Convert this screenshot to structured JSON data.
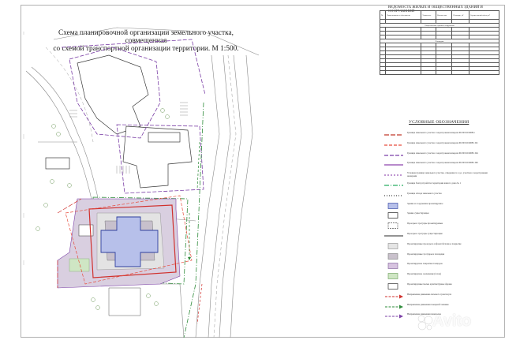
{
  "title_lines": [
    "Схема планировочной организации земельного участка, совмещенная",
    "со схемой транспортной организации территории. М 1:500."
  ],
  "table": {
    "title": "ВЕДОМОСТЬ ЖИЛЫХ И ОБЩЕСТВЕННЫХ ЗДАНИЙ И СООРУЖЕНИЙ",
    "headers": [
      "№",
      "Наименование и обозначение",
      "Этажность",
      "Количество",
      "Площадь, м²",
      "Строительный объем, м³"
    ],
    "section_1": "Общественные здания и сооружения",
    "section_2": "Площадки",
    "colors": {
      "line": "#555555"
    }
  },
  "legend": {
    "title": "УСЛОВНЫЕ ОБОЗНАЧЕНИЯ",
    "items": [
      {
        "label": "Граница земельного участка с кадастровым номером 66:39:0101008:4",
        "symbol": "line",
        "color": "#c0392b",
        "dash": "6 2"
      },
      {
        "label": "Граница земельного участка с кадастровым номером 66:39:0101008:1191",
        "symbol": "line",
        "color": "#e74c3c",
        "dash": "4 2"
      },
      {
        "label": "Граница земельного участка с кадастровым номером 66:39:0101008:1194",
        "symbol": "line",
        "color": "#7b3fa6",
        "dash": "5 2"
      },
      {
        "label": "Граница земельного участка с кадастровым номером 66:39:0101008:1196",
        "symbol": "line",
        "color": "#8e44ad",
        "dash": "none"
      },
      {
        "label": "Условная граница земельного участка, отведенного в д.з. участков с кадастровыми номерами",
        "symbol": "line",
        "color": "#9b59b6",
        "dash": "2 2"
      },
      {
        "label": "Граница благоустройства территории жилого дома № 1",
        "symbol": "line",
        "color": "#27ae60",
        "dash": "6 2 1 2"
      },
      {
        "label": "Граница отвода земельного участка",
        "symbol": "line",
        "color": "#444444",
        "dash": "1 2"
      },
      {
        "label": "Здание и сооружение проектируемое",
        "symbol": "box",
        "color": "#3d4fa8",
        "fill": "#b7c0ea"
      },
      {
        "label": "Здание существующее",
        "symbol": "box",
        "color": "#222222",
        "fill": "#ffffff"
      },
      {
        "label": "Проезды и тротуары проектируемые",
        "symbol": "box",
        "color": "#555555",
        "fill": "#ffffff",
        "dash": "2 1"
      },
      {
        "label": "Проезды и тротуары существующие",
        "symbol": "line",
        "color": "#555555",
        "dash": "none"
      },
      {
        "label": "Проектируемые проезды и асфальтобетонное покрытие",
        "symbol": "box",
        "color": "#999999",
        "fill": "#e5e5e5"
      },
      {
        "label": "Проектируемые тротуары и площадки",
        "symbol": "box",
        "color": "#888888",
        "fill": "#c9c1cc"
      },
      {
        "label": "Проектируемое покрытие площадок",
        "symbol": "box",
        "color": "#8a6ea3",
        "fill": "#d7c3e0"
      },
      {
        "label": "Проектируемое озеленение (газон)",
        "symbol": "box",
        "color": "#7aa86b",
        "fill": "#cfe6c4"
      },
      {
        "label": "Проектируемые малые архитектурные формы",
        "symbol": "box",
        "color": "#333333",
        "fill": "#ffffff"
      },
      {
        "label": "Направление движения легкового транспорта",
        "symbol": "arrow",
        "color": "#d0312d"
      },
      {
        "label": "Направление движения пожарной техники",
        "symbol": "arrow",
        "color": "#2e8b3a"
      },
      {
        "label": "Направление движения пешеходов",
        "symbol": "arrow",
        "color": "#7b3fa6"
      }
    ]
  },
  "colors": {
    "road": "#8a8a8a",
    "building_existing": "#444444",
    "building_new_fill": "#b7c0ea",
    "building_new_stroke": "#2f3f9e",
    "boundary_red": "#d0312d",
    "boundary_green": "#2e8b3a",
    "boundary_purple": "#7b3fa6",
    "zone_fill": "#d9cfe0",
    "lawn": "#cfe6c4"
  },
  "watermark": "Avito"
}
